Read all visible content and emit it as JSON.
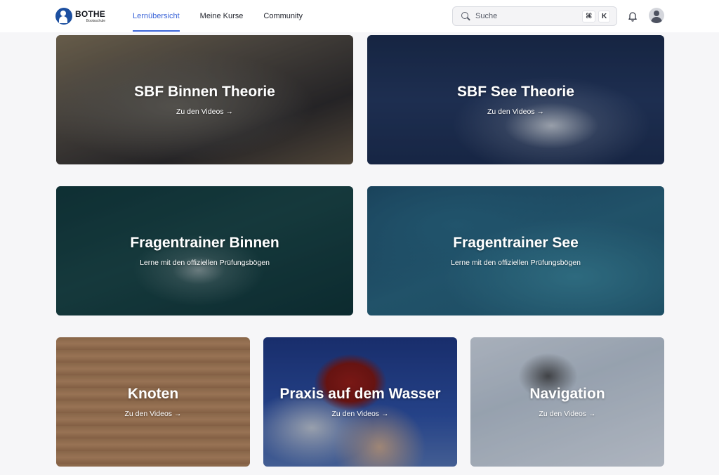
{
  "brand": {
    "name": "BOTHE",
    "sub": "Bootsschule"
  },
  "nav": [
    {
      "label": "Lernübersicht",
      "active": true
    },
    {
      "label": "Meine Kurse",
      "active": false
    },
    {
      "label": "Community",
      "active": false
    }
  ],
  "search": {
    "placeholder": "Suche",
    "shortcut_mod": "⌘",
    "shortcut_key": "K"
  },
  "icons": {
    "search": "search-icon",
    "bell": "bell-icon",
    "avatar": "user-avatar-icon"
  },
  "accent_color": "#3a64d8",
  "cards": [
    {
      "title": "SBF Binnen Theorie",
      "subtitle": "Zu den Videos →"
    },
    {
      "title": "SBF See Theorie",
      "subtitle": "Zu den Videos →"
    },
    {
      "title": "Fragentrainer Binnen",
      "subtitle": "Lerne mit den offiziellen Prüfungsbögen"
    },
    {
      "title": "Fragentrainer See",
      "subtitle": "Lerne mit den offiziellen Prüfungsbögen"
    },
    {
      "title": "Knoten",
      "subtitle": "Zu den Videos →"
    },
    {
      "title": "Praxis auf dem Wasser",
      "subtitle": "Zu den Videos →"
    },
    {
      "title": "Navigation",
      "subtitle": "Zu den Videos →"
    }
  ]
}
